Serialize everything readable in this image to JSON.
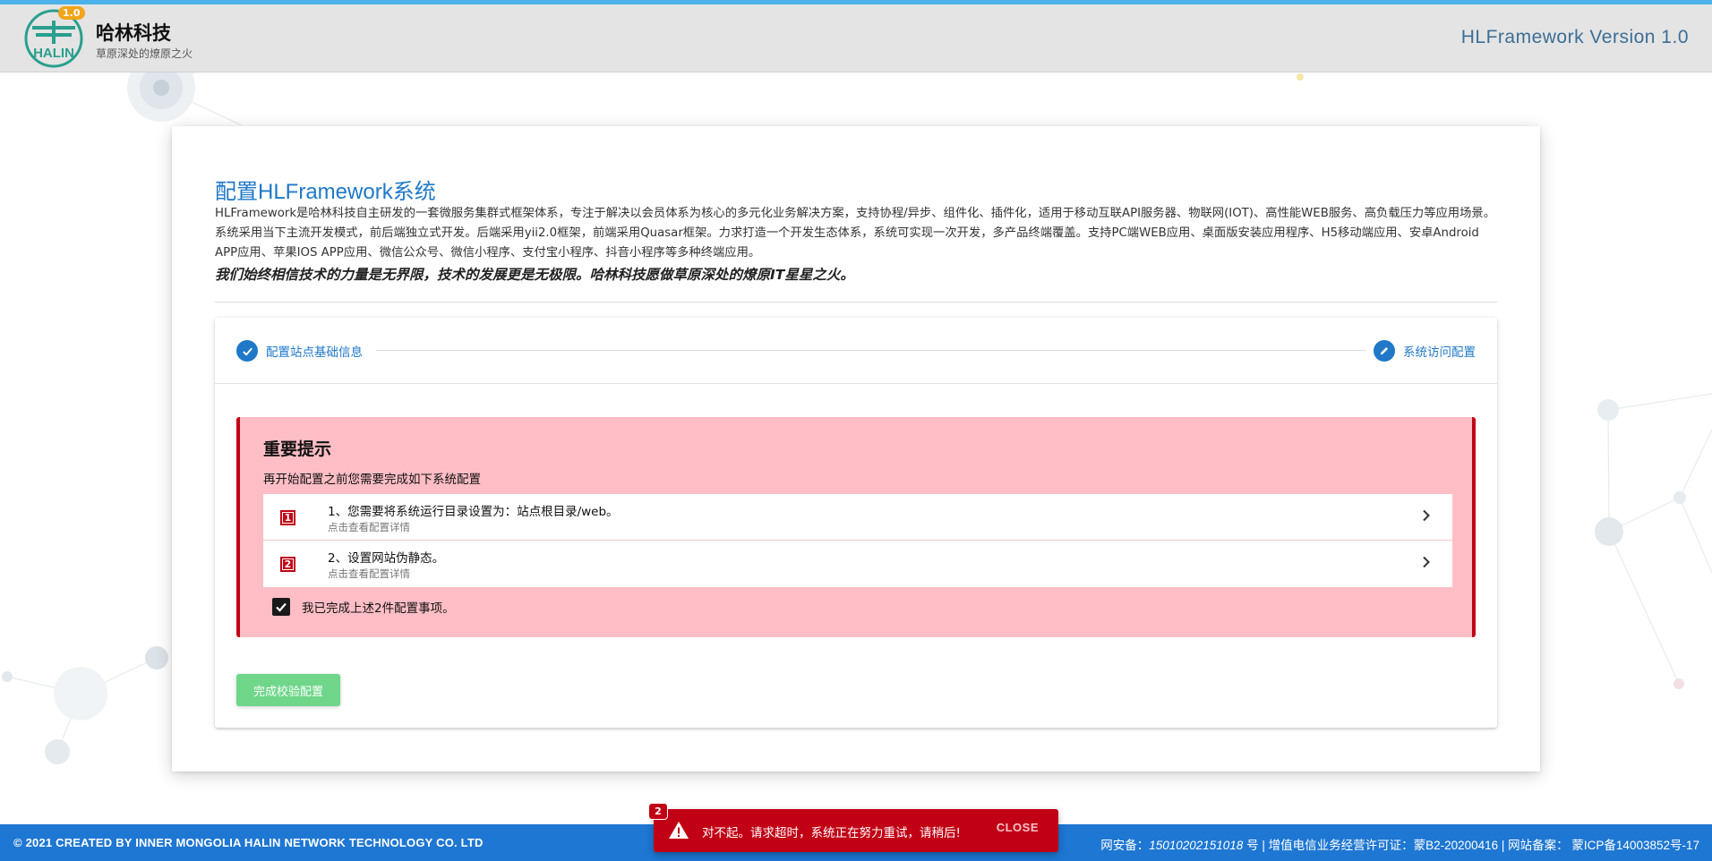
{
  "header": {
    "version_badge": "1.0",
    "brand_name": "哈林科技",
    "brand_slogan": "草原深处的燎原之火",
    "version_text": "HLFramework Version 1.0",
    "logo_icon": "halin-logo-icon"
  },
  "main": {
    "title": "配置HLFramework系统",
    "intro": "HLFramework是哈林科技自主研发的一套微服务集群式框架体系，专注于解决以会员体系为核心的多元化业务解决方案，支持协程/异步、组件化、插件化，适用于移动互联API服务器、物联网(IOT)、高性能WEB服务、高负载压力等应用场景。系统采用当下主流开发模式，前后端独立式开发。后端采用yii2.0框架，前端采用Quasar框架。力求打造一个开发生态体系，系统可实现一次开发，多产品终端覆盖。支持PC端WEB应用、桌面版安装应用程序、H5移动端应用、安卓Android APP应用、苹果IOS APP应用、微信公众号、微信小程序、支付宝小程序、抖音小程序等多种终端应用。",
    "motto": "我们始终相信技术的力量是无界限，技术的发展更是无极限。哈林科技愿做草原深处的燎原IT星星之火。",
    "steps": [
      {
        "label": "配置站点基础信息",
        "icon": "check-icon"
      },
      {
        "label": "系统访问配置",
        "icon": "pencil-icon"
      }
    ],
    "alert": {
      "title": "重要提示",
      "subtitle": "再开始配置之前您需要完成如下系统配置",
      "items": [
        {
          "num": "1",
          "title": "1、您需要将系统运行目录设置为：站点根目录/web。",
          "caption": "点击查看配置详情"
        },
        {
          "num": "2",
          "title": "2、设置网站伪静态。",
          "caption": "点击查看配置详情"
        }
      ],
      "confirm_label": "我已完成上述2件配置事项。",
      "confirm_checked": true
    },
    "complete_button": "完成校验配置"
  },
  "footer": {
    "copyright": "© 2021   CREATED BY INNER MONGOLIA HALIN NETWORK TECHNOLOGY CO. LTD",
    "license_prefix": "网安备：",
    "license_number": "15010202151018",
    "license_suffix": " 号 | 增值电信业务经营许可证：蒙B2-20200416 | 网站备案：  蒙ICP备14003852号-17"
  },
  "notification": {
    "count": "2",
    "message": "对不起。请求超时，系统正在努力重试，请稍后!",
    "close_label": "CLOSE",
    "icon": "warning-icon"
  },
  "colors": {
    "primary": "#1f78c8",
    "negative": "#c10015",
    "alert_bg": "#ffbec5",
    "positive_btn": "#6fd68a",
    "footer_bg": "#1e77d3",
    "header_bg": "#e4e4e4"
  }
}
